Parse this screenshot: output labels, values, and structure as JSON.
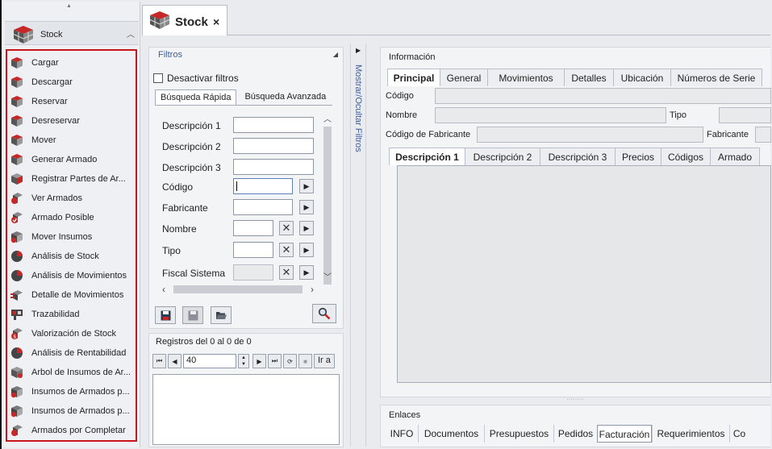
{
  "nav": {
    "title": "Stock",
    "items": [
      {
        "label": "Cargar",
        "icon": "cube-icon"
      },
      {
        "label": "Descargar",
        "icon": "cube-icon"
      },
      {
        "label": "Reservar",
        "icon": "cube-icon"
      },
      {
        "label": "Desreservar",
        "icon": "cube-icon"
      },
      {
        "label": "Mover",
        "icon": "cube-icon"
      },
      {
        "label": "Generar Armado",
        "icon": "cube-icon"
      },
      {
        "label": "Registrar Partes de Ar...",
        "icon": "parts-icon"
      },
      {
        "label": "Ver Armados",
        "icon": "assembly-icon"
      },
      {
        "label": "Armado Posible",
        "icon": "assembly-check-icon"
      },
      {
        "label": "Mover Insumos",
        "icon": "supplies-icon"
      },
      {
        "label": "Análisis de Stock",
        "icon": "pie-chart-icon"
      },
      {
        "label": "Análisis de Movimientos",
        "icon": "pie-chart-icon"
      },
      {
        "label": "Detalle de Movimientos",
        "icon": "movement-detail-icon"
      },
      {
        "label": "Trazabilidad",
        "icon": "traceability-icon"
      },
      {
        "label": "Valorización de Stock",
        "icon": "valuation-icon"
      },
      {
        "label": "Análisis de Rentabilidad",
        "icon": "pie-chart-icon"
      },
      {
        "label": "Arbol de Insumos de Ar...",
        "icon": "tree-icon"
      },
      {
        "label": "Insumos de Armados p...",
        "icon": "supplies-icon"
      },
      {
        "label": "Insumos de Armados p...",
        "icon": "supplies-icon"
      },
      {
        "label": "Armados por Completar",
        "icon": "assembly-icon"
      }
    ]
  },
  "doc_tab": {
    "title": "Stock",
    "close": "×"
  },
  "filters": {
    "title": "Filtros",
    "disable_label": "Desactivar filtros",
    "tabs": [
      "Búsqueda Rápida",
      "Búsqueda Avanzada"
    ],
    "fields": [
      {
        "label": "Descripción 1",
        "value": ""
      },
      {
        "label": "Descripción 2",
        "value": ""
      },
      {
        "label": "Descripción 3",
        "value": ""
      },
      {
        "label": "Código",
        "value": ""
      },
      {
        "label": "Fabricante",
        "value": ""
      },
      {
        "label": "Nombre",
        "value": ""
      },
      {
        "label": "Tipo",
        "value": ""
      },
      {
        "label": "Fiscal Sistema",
        "value": ""
      }
    ]
  },
  "registros": {
    "title": "Registros del 0 al 0 de 0",
    "page_value": "40",
    "go_label": "Ir a"
  },
  "strip": {
    "label": "Mostrar/Ocultar Filtros"
  },
  "info": {
    "title": "Información",
    "tabs": [
      "Principal",
      "General",
      "Movimientos",
      "Detalles",
      "Ubicación",
      "Números de Serie"
    ],
    "codigo_label": "Código",
    "nombre_label": "Nombre",
    "tipo_label": "Tipo",
    "codfab_label": "Código de Fabricante",
    "fabricante_label": "Fabricante",
    "desc_tabs": [
      "Descripción 1",
      "Descripción 2",
      "Descripción 3",
      "Precios",
      "Códigos",
      "Armado"
    ]
  },
  "enlaces": {
    "title": "Enlaces",
    "tabs": [
      "INFO",
      "Documentos",
      "Presupuestos",
      "Pedidos",
      "Facturación",
      "Requerimientos",
      "Co"
    ]
  },
  "colors": {
    "accent": "#c8151b",
    "header_blue": "#3b5f9e"
  }
}
